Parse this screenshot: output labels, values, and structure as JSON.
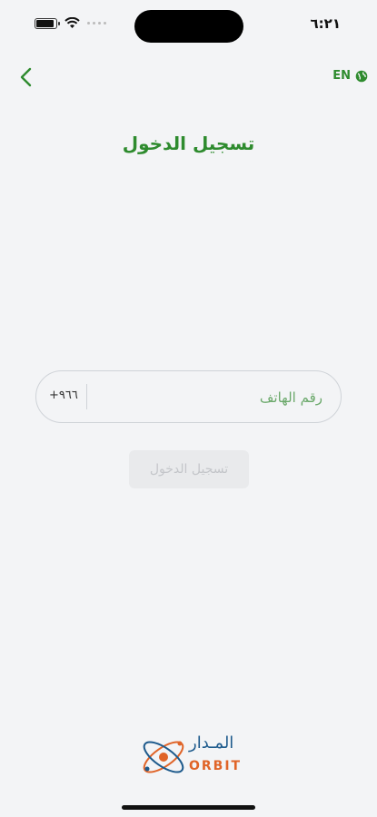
{
  "status_bar": {
    "time": "٦:٢١"
  },
  "header": {
    "lang_label": "EN"
  },
  "page": {
    "title": "تسجيل الدخول"
  },
  "phone": {
    "placeholder": "رقم الهاتف",
    "country_code": "+٩٦٦"
  },
  "actions": {
    "login_label": "تسجيل الدخول"
  },
  "logo": {
    "arabic": "المـدار",
    "english": "ORBIT"
  },
  "colors": {
    "brand_green": "#2e8b2e",
    "logo_blue": "#1d5a8c",
    "logo_orange": "#e06428",
    "background": "#f3f4f6"
  }
}
